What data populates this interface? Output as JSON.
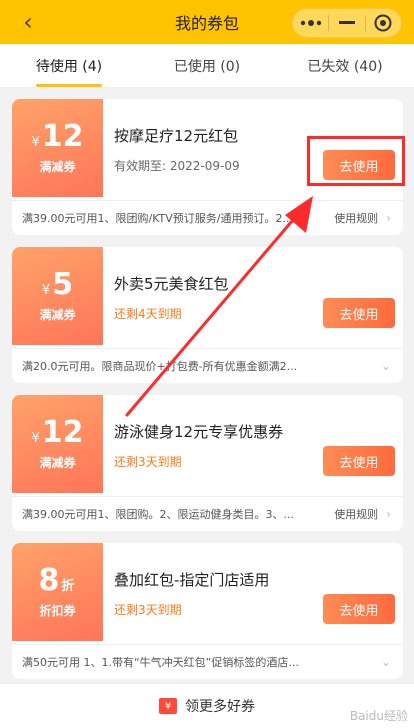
{
  "header": {
    "title": "我的券包",
    "back_glyph": "‹",
    "icons": [
      "back-icon",
      "more-dots-icon",
      "minimize-icon",
      "target-close-icon"
    ]
  },
  "tabs": [
    {
      "label": "待使用 (4)"
    },
    {
      "label": "已使用 (0)"
    },
    {
      "label": "已失效 (40)"
    }
  ],
  "coupons": [
    {
      "symbol": "¥",
      "amount": "12",
      "type": "满减券",
      "title": "按摩足疗12元红包",
      "subtitle": "有效期至: 2022-09-09",
      "button": "去使用",
      "rule": "满39.00元可用1、限团购/KTV预订服务/通用预订。2...",
      "rule_link": "使用规则"
    },
    {
      "symbol": "¥",
      "amount": "5",
      "type": "满减券",
      "title": "外卖5元美食红包",
      "subtitle": "还剩4天到期",
      "button": "去使用",
      "rule": "满20.0元可用。限商品现价+打包费-所有优惠金额满2...",
      "rule_link": ""
    },
    {
      "symbol": "¥",
      "amount": "12",
      "type": "满减券",
      "title": "游泳健身12元专享优惠券",
      "subtitle": "还剩3天到期",
      "button": "去使用",
      "rule": "满39.00元可用1、限团购。2、限运动健身类目。3、...",
      "rule_link": "使用规则"
    },
    {
      "symbol": "",
      "amount": "8",
      "unit": "折",
      "type": "折扣券",
      "title": "叠加红包-指定门店适用",
      "subtitle": "还剩3天到期",
      "button": "去使用",
      "rule": "满50元可用 1、1.带有“牛气冲天红包”促销标签的酒店...",
      "rule_link": ""
    }
  ],
  "bottom": {
    "label": "领更多好券"
  },
  "watermark": "Baidu经验",
  "colors": {
    "header": "#ffc300",
    "badge_start": "#ffa26a",
    "badge_end": "#ff7558",
    "warning": "#ff7a1a",
    "annotation": "#ff2a2a"
  }
}
